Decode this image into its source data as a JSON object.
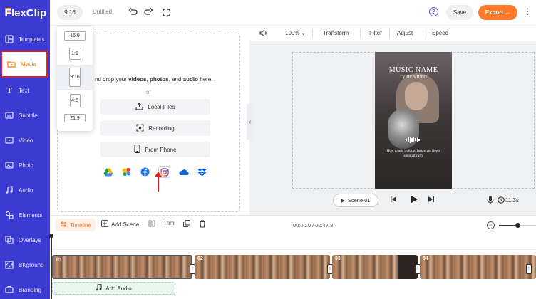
{
  "app": {
    "logo_text": "FlexClip"
  },
  "sidebar": {
    "items": [
      {
        "label": "Templates",
        "icon": "templates-icon"
      },
      {
        "label": "Media",
        "icon": "media-icon",
        "active": true
      },
      {
        "label": "Text",
        "icon": "text-icon"
      },
      {
        "label": "Subtitle",
        "icon": "subtitle-icon"
      },
      {
        "label": "Video",
        "icon": "video-icon"
      },
      {
        "label": "Photo",
        "icon": "photo-icon"
      },
      {
        "label": "Audio",
        "icon": "audio-icon"
      },
      {
        "label": "Elements",
        "icon": "elements-icon"
      },
      {
        "label": "Overlays",
        "icon": "overlays-icon"
      },
      {
        "label": "BKground",
        "icon": "background-icon"
      },
      {
        "label": "Branding",
        "icon": "branding-icon"
      }
    ]
  },
  "topbar": {
    "ratio_label": "9:16",
    "project_title": "Untitled",
    "save_label": "Save",
    "export_label": "Export"
  },
  "ratio_menu": {
    "options": [
      "16:9",
      "1:1",
      "9:16",
      "4:5",
      "21:9"
    ],
    "selected": "9:16"
  },
  "media": {
    "drop_prefix": "nd drop your",
    "drop_videos": "videos",
    "drop_sep1": ",",
    "drop_photos": "photos",
    "drop_sep2": ", and",
    "drop_audio": "audio",
    "drop_suffix": "here.",
    "or_text": "or",
    "local_files_label": "Local Files",
    "recording_label": "Recording",
    "from_phone_label": "From Phone",
    "cloud_sources": [
      "google-drive-icon",
      "google-photos-icon",
      "facebook-icon",
      "instagram-icon",
      "onedrive-icon",
      "dropbox-icon"
    ]
  },
  "preview": {
    "zoom": "100%",
    "tools": [
      "Transform",
      "Filter",
      "Adjust",
      "Speed"
    ],
    "video_title": "MUSIC NAME",
    "video_subtitle": "LYRIC VIDEO",
    "video_caption": "How to add lyrics to Instagram Reels automatically",
    "scene_label": "Scene 01",
    "duration": "11.3s"
  },
  "timeline": {
    "timeline_label": "Timeline",
    "add_scene_label": "Add Scene",
    "trim_label": "Trim",
    "time_readout": "00:00.0 / 00:47.3",
    "zoom_level": 0.5,
    "clips": [
      "01",
      "02",
      "03",
      "04"
    ],
    "add_audio_label": "Add Audio"
  },
  "colors": {
    "sidebar_bg": "#3b3bd4",
    "accent_orange": "#ff7a2b",
    "highlight_red": "#e01e1e"
  }
}
